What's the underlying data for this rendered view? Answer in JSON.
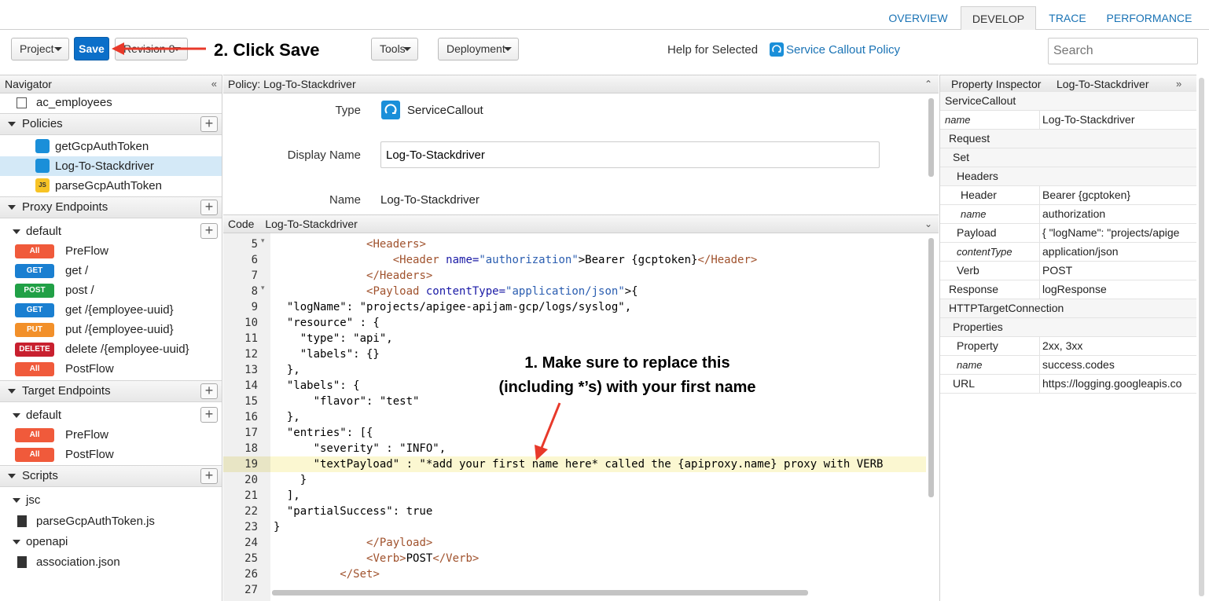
{
  "tabs": [
    {
      "label": "OVERVIEW",
      "active": false
    },
    {
      "label": "DEVELOP",
      "active": true
    },
    {
      "label": "TRACE",
      "active": false
    },
    {
      "label": "PERFORMANCE",
      "active": false
    }
  ],
  "toolbar": {
    "project": "Project",
    "save": "Save",
    "revision": "Revision 8",
    "tools": "Tools",
    "deployment": "Deployment",
    "help_for_selected": "Help for Selected",
    "help_link": "Service Callout Policy",
    "search_placeholder": "Search"
  },
  "annotations": {
    "step2": "2. Click Save",
    "step1_line1": "1. Make sure to replace this",
    "step1_line2": "(including *’s) with your first name"
  },
  "navigator": {
    "title": "Navigator",
    "collapse": "«",
    "top_item": "ac_employees",
    "policies_header": "Policies",
    "policies": [
      {
        "label": "getGcpAuthToken",
        "icon": "service-callout-icon"
      },
      {
        "label": "Log-To-Stackdriver",
        "icon": "service-callout-icon",
        "selected": true
      },
      {
        "label": "parseGcpAuthToken",
        "icon": "javascript-icon",
        "icon_text": "JS"
      }
    ],
    "proxy_header": "Proxy Endpoints",
    "proxy_default": "default",
    "proxy_flows": [
      {
        "verb": "All",
        "label": "PreFlow",
        "color": "#f05a3b"
      },
      {
        "verb": "GET",
        "label": "get /",
        "color": "#1a7fd1"
      },
      {
        "verb": "POST",
        "label": "post /",
        "color": "#21a046"
      },
      {
        "verb": "GET",
        "label": "get /{employee-uuid}",
        "color": "#1a7fd1"
      },
      {
        "verb": "PUT",
        "label": "put /{employee-uuid}",
        "color": "#f2902a"
      },
      {
        "verb": "DELETE",
        "label": "delete /{employee-uuid}",
        "color": "#c8202f"
      },
      {
        "verb": "All",
        "label": "PostFlow",
        "color": "#f05a3b"
      }
    ],
    "target_header": "Target Endpoints",
    "target_default": "default",
    "target_flows": [
      {
        "verb": "All",
        "label": "PreFlow",
        "color": "#f05a3b"
      },
      {
        "verb": "All",
        "label": "PostFlow",
        "color": "#f05a3b"
      }
    ],
    "scripts_header": "Scripts",
    "jsc_folder": "jsc",
    "jsc_file": "parseGcpAuthToken.js",
    "openapi_folder": "openapi",
    "openapi_file": "association.json"
  },
  "policy": {
    "header": "Policy: Log-To-Stackdriver",
    "type_label": "Type",
    "type_value": "ServiceCallout",
    "display_name_label": "Display Name",
    "display_name_value": "Log-To-Stackdriver",
    "name_label": "Name",
    "name_value": "Log-To-Stackdriver"
  },
  "code": {
    "header_label": "Code",
    "header_name": "Log-To-Stackdriver",
    "line_numbers": [
      "5",
      "6",
      "7",
      "8",
      "9",
      "10",
      "11",
      "12",
      "13",
      "14",
      "15",
      "16",
      "17",
      "18",
      "19",
      "20",
      "21",
      "22",
      "23",
      "24",
      "25",
      "26",
      "27"
    ],
    "lines": {
      "l9": "  \"logName\": \"projects/apigee-apijam-gcp/logs/syslog\",",
      "l10": "  \"resource\" : {",
      "l11": "    \"type\": \"api\",",
      "l12": "    \"labels\": {}",
      "l13": "  },",
      "l14": "  \"labels\": {",
      "l15": "      \"flavor\": \"test\"",
      "l16": "  },",
      "l17": "  \"entries\": [{",
      "l18": "      \"severity\" : \"INFO\",",
      "l19": "      \"textPayload\" : \"*add your first name here* called the {apiproxy.name} proxy with VERB",
      "l20": "    }",
      "l21": "  ],",
      "l22": "  \"partialSuccess\": true",
      "l23": "}"
    },
    "tags": {
      "headers_open": "<Headers>",
      "header_open": "<Header",
      "header_attr": " name=",
      "header_attr_val": "\"authorization\"",
      "header_text": ">Bearer {gcptoken}",
      "header_close": "</Header>",
      "headers_close": "</Headers>",
      "payload_open": "<Payload",
      "payload_attr": " contentType=",
      "payload_attr_val": "\"application/json\"",
      "payload_brace": ">{",
      "payload_close": "</Payload>",
      "verb_open": "<Verb>",
      "verb_text": "POST",
      "verb_close": "</Verb>",
      "set_close": "</Set>"
    }
  },
  "inspector": {
    "title": "Property Inspector",
    "policy_name": "Log-To-Stackdriver",
    "expand": "»",
    "rows": [
      {
        "key": "ServiceCallout",
        "full": true
      },
      {
        "key": "name",
        "value": "Log-To-Stackdriver",
        "italic": true
      },
      {
        "key": "Request",
        "full": true,
        "indent": 1
      },
      {
        "key": "Set",
        "full": true,
        "indent": 2
      },
      {
        "key": "Headers",
        "full": true,
        "indent": 3
      },
      {
        "key": "Header",
        "value": "Bearer {gcptoken}",
        "indent": 4
      },
      {
        "key": "name",
        "value": "authorization",
        "italic": true,
        "indent": 4
      },
      {
        "key": "Payload",
        "value": "{  \"logName\": \"projects/apige",
        "indent": 3
      },
      {
        "key": "contentType",
        "value": "application/json",
        "italic": true,
        "indent": 3
      },
      {
        "key": "Verb",
        "value": "POST",
        "indent": 3
      },
      {
        "key": "Response",
        "value": "logResponse",
        "indent": 1
      },
      {
        "key": "HTTPTargetConnection",
        "full": true,
        "indent": 1
      },
      {
        "key": "Properties",
        "full": true,
        "indent": 2
      },
      {
        "key": "Property",
        "value": "2xx, 3xx",
        "indent": 3
      },
      {
        "key": "name",
        "value": "success.codes",
        "italic": true,
        "indent": 3
      },
      {
        "key": "URL",
        "value": "https://logging.googleapis.co",
        "indent": 2
      }
    ]
  }
}
